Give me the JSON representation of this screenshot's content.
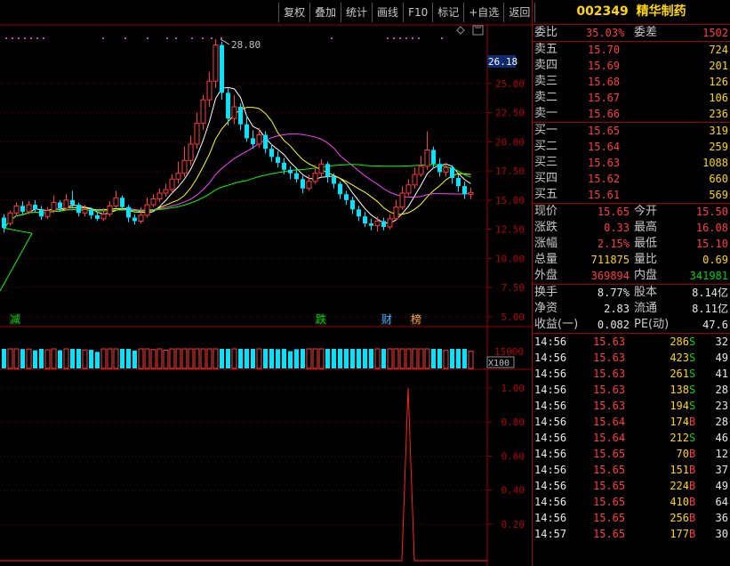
{
  "toolbar": {
    "buttons": [
      "复权",
      "叠加",
      "统计",
      "画线",
      "F10",
      "标记",
      "+自选",
      "返回"
    ]
  },
  "chart": {
    "max_annotation": "28.80",
    "current_price_tag": "26.18",
    "price_axis": [
      "25.00",
      "22.50",
      "20.00",
      "17.50",
      "15.00",
      "12.50",
      "10.00",
      "7.50",
      "5.00"
    ],
    "volume_axis": "15000",
    "volume_unit": "X100",
    "indicator_axis": [
      "1.00",
      "0.80",
      "0.60",
      "0.40",
      "0.20"
    ],
    "event_labels": [
      {
        "text": "减",
        "color": "#00d200"
      },
      {
        "text": "跌",
        "color": "#00d200"
      },
      {
        "text": "财",
        "color": "#4aa8ff"
      },
      {
        "text": "榜",
        "color": "#ffa040"
      }
    ]
  },
  "stock": {
    "code": "002349",
    "name": "精华制药"
  },
  "order_book": {
    "weibi_label": "委比",
    "weibi_value": "35.03%",
    "weicha_label": "委差",
    "weicha_value": "1502",
    "sell": [
      {
        "label": "卖五",
        "price": "15.70",
        "vol": "724"
      },
      {
        "label": "卖四",
        "price": "15.69",
        "vol": "201"
      },
      {
        "label": "卖三",
        "price": "15.68",
        "vol": "126"
      },
      {
        "label": "卖二",
        "price": "15.67",
        "vol": "106"
      },
      {
        "label": "卖一",
        "price": "15.66",
        "vol": "236"
      }
    ],
    "buy": [
      {
        "label": "买一",
        "price": "15.65",
        "vol": "319"
      },
      {
        "label": "买二",
        "price": "15.64",
        "vol": "259"
      },
      {
        "label": "买三",
        "price": "15.63",
        "vol": "1088"
      },
      {
        "label": "买四",
        "price": "15.62",
        "vol": "660"
      },
      {
        "label": "买五",
        "price": "15.61",
        "vol": "569"
      }
    ]
  },
  "quote": [
    {
      "l1": "现价",
      "v1": "15.65",
      "c1": "red",
      "l2": "今开",
      "v2": "15.50",
      "c2": "red"
    },
    {
      "l1": "涨跌",
      "v1": "0.33",
      "c1": "red",
      "l2": "最高",
      "v2": "16.08",
      "c2": "red"
    },
    {
      "l1": "涨幅",
      "v1": "2.15%",
      "c1": "red",
      "l2": "最低",
      "v2": "15.10",
      "c2": "red"
    },
    {
      "l1": "总量",
      "v1": "711875",
      "c1": "yellow",
      "l2": "量比",
      "v2": "0.69",
      "c2": "yellow"
    },
    {
      "l1": "外盘",
      "v1": "369894",
      "c1": "red",
      "l2": "内盘",
      "v2": "341981",
      "c2": "green"
    }
  ],
  "fundamentals": [
    {
      "l1": "换手",
      "v1": "8.77%",
      "l2": "股本",
      "v2": "8.14亿"
    },
    {
      "l1": "净资",
      "v1": "2.83",
      "l2": "流通",
      "v2": "8.11亿"
    },
    {
      "l1": "收益(一)",
      "v1": "0.082",
      "l2": "PE(动)",
      "v2": "47.6"
    }
  ],
  "ticks": [
    {
      "time": "14:56",
      "price": "15.63",
      "vol": "286",
      "side": "S",
      "n": "32"
    },
    {
      "time": "14:56",
      "price": "15.63",
      "vol": "423",
      "side": "S",
      "n": "49"
    },
    {
      "time": "14:56",
      "price": "15.63",
      "vol": "261",
      "side": "S",
      "n": "41"
    },
    {
      "time": "14:56",
      "price": "15.63",
      "vol": "138",
      "side": "S",
      "n": "28"
    },
    {
      "time": "14:56",
      "price": "15.63",
      "vol": "194",
      "side": "S",
      "n": "23"
    },
    {
      "time": "14:56",
      "price": "15.64",
      "vol": "174",
      "side": "B",
      "n": "28"
    },
    {
      "time": "14:56",
      "price": "15.64",
      "vol": "212",
      "side": "S",
      "n": "46"
    },
    {
      "time": "14:56",
      "price": "15.65",
      "vol": "70",
      "side": "B",
      "n": "12"
    },
    {
      "time": "14:56",
      "price": "15.65",
      "vol": "151",
      "side": "B",
      "n": "37"
    },
    {
      "time": "14:56",
      "price": "15.65",
      "vol": "224",
      "side": "B",
      "n": "49"
    },
    {
      "time": "14:56",
      "price": "15.65",
      "vol": "410",
      "side": "B",
      "n": "64"
    },
    {
      "time": "14:56",
      "price": "15.65",
      "vol": "256",
      "side": "B",
      "n": "36"
    },
    {
      "time": "14:57",
      "price": "15.65",
      "vol": "177",
      "side": "B",
      "n": "30"
    }
  ],
  "chart_data": {
    "type": "candlestick",
    "candles": [
      [
        13.5,
        12.6,
        13.8,
        12.2
      ],
      [
        13.0,
        13.9,
        14.1,
        12.8
      ],
      [
        13.9,
        14.5,
        14.8,
        13.6
      ],
      [
        14.5,
        14.0,
        14.9,
        13.8
      ],
      [
        14.0,
        14.6,
        14.9,
        13.8
      ],
      [
        14.6,
        14.2,
        15.0,
        14.0
      ],
      [
        14.2,
        13.6,
        14.5,
        13.3
      ],
      [
        13.6,
        14.1,
        14.4,
        13.4
      ],
      [
        14.1,
        14.8,
        15.4,
        13.9
      ],
      [
        14.8,
        14.3,
        15.0,
        14.0
      ],
      [
        14.3,
        15.0,
        15.5,
        14.1
      ],
      [
        15.0,
        14.6,
        15.8,
        14.3
      ],
      [
        14.6,
        13.9,
        14.8,
        13.6
      ],
      [
        13.9,
        14.2,
        14.6,
        13.6
      ],
      [
        14.2,
        13.7,
        14.4,
        13.4
      ],
      [
        13.7,
        13.4,
        14.0,
        13.2
      ],
      [
        13.4,
        13.8,
        14.3,
        13.2
      ],
      [
        13.8,
        14.5,
        14.9,
        13.6
      ],
      [
        14.5,
        15.2,
        15.8,
        14.3
      ],
      [
        15.2,
        14.4,
        15.4,
        14.1
      ],
      [
        14.4,
        13.5,
        14.6,
        13.1
      ],
      [
        13.5,
        13.2,
        13.8,
        12.9
      ],
      [
        13.2,
        13.7,
        14.4,
        13.0
      ],
      [
        13.7,
        14.6,
        15.2,
        13.5
      ],
      [
        14.6,
        15.1,
        15.5,
        14.4
      ],
      [
        15.1,
        15.6,
        16.0,
        14.8
      ],
      [
        15.6,
        15.9,
        16.4,
        15.3
      ],
      [
        15.9,
        16.8,
        17.2,
        15.6
      ],
      [
        16.8,
        17.3,
        18.3,
        16.4
      ],
      [
        17.3,
        18.4,
        19.6,
        17.0
      ],
      [
        18.4,
        19.8,
        20.5,
        18.0
      ],
      [
        19.8,
        21.6,
        22.5,
        19.4
      ],
      [
        21.6,
        23.6,
        24.0,
        21.0
      ],
      [
        23.6,
        25.2,
        26.0,
        23.0
      ],
      [
        25.2,
        28.3,
        28.8,
        24.6
      ],
      [
        28.3,
        24.2,
        28.6,
        23.6
      ],
      [
        24.2,
        22.0,
        24.6,
        21.4
      ],
      [
        22.0,
        23.0,
        24.0,
        21.5
      ],
      [
        23.0,
        21.5,
        23.3,
        21.0
      ],
      [
        21.5,
        20.3,
        22.3,
        20.0
      ],
      [
        20.3,
        19.8,
        21.0,
        19.4
      ],
      [
        19.8,
        20.6,
        21.2,
        19.5
      ],
      [
        20.6,
        19.4,
        20.9,
        19.0
      ],
      [
        19.4,
        18.7,
        19.8,
        18.3
      ],
      [
        18.7,
        18.2,
        19.2,
        17.8
      ],
      [
        18.2,
        17.6,
        18.6,
        17.2
      ],
      [
        17.6,
        17.3,
        17.9,
        16.8
      ],
      [
        17.3,
        16.8,
        17.8,
        16.5
      ],
      [
        16.8,
        16.0,
        17.1,
        15.6
      ],
      [
        16.0,
        16.6,
        17.2,
        15.8
      ],
      [
        16.6,
        17.3,
        18.0,
        16.4
      ],
      [
        17.3,
        18.1,
        18.5,
        17.0
      ],
      [
        18.1,
        17.0,
        18.3,
        16.5
      ],
      [
        17.0,
        16.4,
        17.3,
        16.0
      ],
      [
        16.4,
        15.5,
        16.6,
        15.1
      ],
      [
        15.5,
        15.0,
        15.8,
        14.6
      ],
      [
        15.0,
        14.2,
        15.3,
        13.8
      ],
      [
        14.2,
        13.6,
        14.5,
        13.2
      ],
      [
        13.6,
        13.0,
        14.0,
        12.7
      ],
      [
        13.0,
        12.8,
        13.4,
        12.4
      ],
      [
        12.8,
        13.2,
        13.6,
        12.3
      ],
      [
        13.2,
        12.7,
        13.5,
        12.4
      ],
      [
        12.7,
        13.4,
        13.8,
        12.5
      ],
      [
        13.4,
        14.4,
        15.0,
        13.2
      ],
      [
        14.4,
        15.6,
        16.2,
        14.2
      ],
      [
        15.6,
        16.3,
        16.8,
        15.4
      ],
      [
        16.3,
        17.2,
        17.8,
        16.0
      ],
      [
        17.2,
        17.9,
        18.8,
        17.0
      ],
      [
        17.9,
        19.3,
        20.9,
        17.6
      ],
      [
        19.3,
        18.1,
        19.6,
        17.7
      ],
      [
        18.1,
        17.4,
        18.6,
        17.0
      ],
      [
        17.4,
        17.8,
        18.2,
        17.0
      ],
      [
        17.8,
        16.9,
        18.0,
        16.4
      ],
      [
        16.9,
        16.2,
        17.2,
        15.7
      ],
      [
        16.2,
        15.5,
        16.6,
        15.1
      ],
      [
        15.5,
        15.65,
        16.08,
        15.1
      ]
    ]
  }
}
